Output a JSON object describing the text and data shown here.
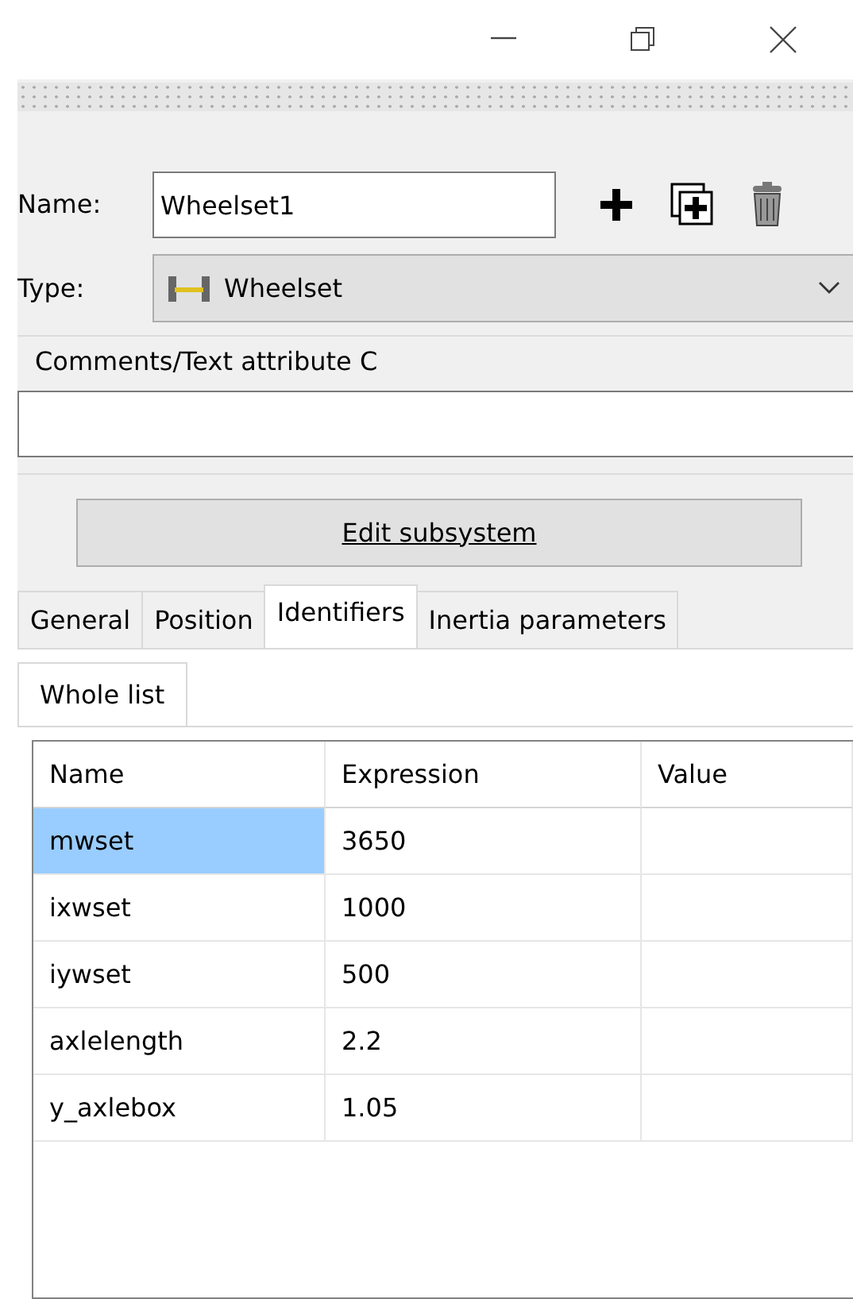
{
  "name_field": {
    "label": "Name:",
    "value": "Wheelset1"
  },
  "type_field": {
    "label": "Type:",
    "value": "Wheelset"
  },
  "comments": {
    "label": "Comments/Text attribute C"
  },
  "edit_button": "Edit subsystem",
  "tabs": [
    {
      "label": "General",
      "selected": false
    },
    {
      "label": "Position",
      "selected": false
    },
    {
      "label": "Identifiers",
      "selected": true
    },
    {
      "label": "Inertia parameters",
      "selected": false
    }
  ],
  "subtabs": [
    {
      "label": "Whole list",
      "selected": true
    }
  ],
  "table": {
    "columns": [
      "Name",
      "Expression",
      "Value"
    ],
    "rows": [
      {
        "cells": [
          "mwset",
          "3650"
        ],
        "selected": true
      },
      {
        "cells": [
          "ixwset",
          "1000"
        ],
        "selected": false
      },
      {
        "cells": [
          "iywset",
          "500"
        ],
        "selected": false
      },
      {
        "cells": [
          "axlelength",
          "2.2"
        ],
        "selected": false
      },
      {
        "cells": [
          "y_axlebox",
          "1.05"
        ],
        "selected": false
      }
    ]
  }
}
